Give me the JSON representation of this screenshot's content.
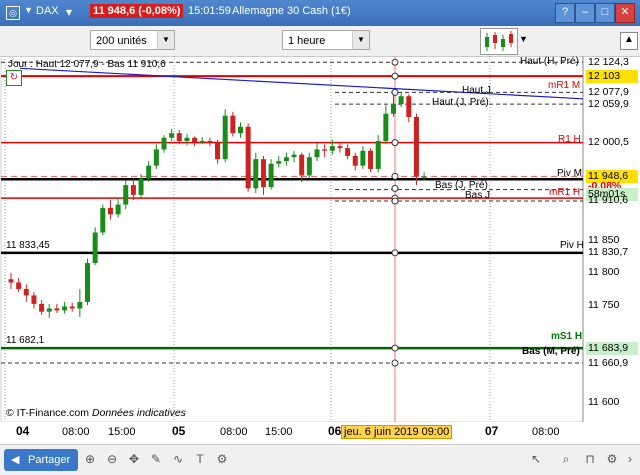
{
  "window": {
    "symbol": "DAX",
    "price_badge": "11 948,6 (-0,08%)",
    "time": "15:01:59",
    "instrument": "Allemagne 30 Cash (1€)"
  },
  "toolbar": {
    "units": "200 unités",
    "timeframe": "1 heure"
  },
  "chart": {
    "info_line": "Jour : Haut 12 077,9 - Bas 11 910,6",
    "copyright": "© IT-Finance.com",
    "disclaimer": "Données indicatives",
    "x_labels": [
      "04",
      "08:00",
      "15:00",
      "05",
      "08:00",
      "15:00",
      "06",
      "07",
      "08:00"
    ],
    "cursor_date": "jeu. 6 juin 2019 09:00",
    "price_axis": [
      "12 124,3",
      "12 103",
      "12 077,9",
      "12 059,9",
      "12 000,5",
      "11 948,6",
      "-0,08%",
      "58m01s",
      "11 910,6",
      "11 850",
      "11 830,7",
      "11 800",
      "11 750",
      "11 683,9",
      "11 660,9",
      "11 600"
    ],
    "levels": {
      "haut_h_pre": "Haut (H, Pré)",
      "mr1_m": "mR1 M",
      "haut_j": "Haut J",
      "haut_j_pre": "Haut (J, Pré)",
      "r1_h": "R1 H",
      "piv_m": "Piv M",
      "bas_j_pre": "Bas (J, Pré)",
      "mr1_h": "mR1 H",
      "bas_j": "Bas J",
      "left_1": "11 833,45",
      "piv_h": "Piv H",
      "left_2": "11 682,1",
      "ms1_h": "mS1 H",
      "bas_m_pre": "Bas (M, Pré)"
    },
    "candles": [
      [
        11790,
        11785,
        11800,
        11775
      ],
      [
        11785,
        11775,
        11792,
        11770
      ],
      [
        11775,
        11765,
        11782,
        11755
      ],
      [
        11765,
        11752,
        11770,
        11745
      ],
      [
        11752,
        11740,
        11758,
        11735
      ],
      [
        11740,
        11745,
        11752,
        11730
      ],
      [
        11745,
        11742,
        11752,
        11738
      ],
      [
        11742,
        11748,
        11755,
        11737
      ],
      [
        11748,
        11745,
        11754,
        11740
      ],
      [
        11745,
        11755,
        11775,
        11732
      ],
      [
        11755,
        11815,
        11822,
        11750
      ],
      [
        11815,
        11862,
        11870,
        11812
      ],
      [
        11862,
        11900,
        11905,
        11858
      ],
      [
        11900,
        11890,
        11912,
        11882
      ],
      [
        11890,
        11905,
        11915,
        11885
      ],
      [
        11905,
        11935,
        11942,
        11898
      ],
      [
        11935,
        11920,
        11945,
        11912
      ],
      [
        11920,
        11945,
        11952,
        11915
      ],
      [
        11945,
        11965,
        11972,
        11940
      ],
      [
        11965,
        11990,
        11998,
        11960
      ],
      [
        11990,
        12008,
        12012,
        11985
      ],
      [
        12008,
        12015,
        12022,
        12003
      ],
      [
        12015,
        12003,
        12020,
        11998
      ],
      [
        12003,
        12008,
        12014,
        11996
      ],
      [
        12008,
        12001,
        12010,
        11995
      ],
      [
        12001,
        12003,
        12009,
        11998
      ],
      [
        12003,
        12000,
        12008,
        11995
      ],
      [
        12000,
        11975,
        12005,
        11968
      ],
      [
        11975,
        12042,
        12052,
        11970
      ],
      [
        12042,
        12015,
        12048,
        12010
      ],
      [
        12015,
        12025,
        12032,
        12008
      ],
      [
        12025,
        11930,
        12030,
        11925
      ],
      [
        11930,
        11975,
        11985,
        11923
      ],
      [
        11975,
        11932,
        11980,
        11920
      ],
      [
        11932,
        11968,
        11975,
        11928
      ],
      [
        11968,
        11972,
        11980,
        11962
      ],
      [
        11972,
        11978,
        11985,
        11965
      ],
      [
        11978,
        11982,
        11988,
        11970
      ],
      [
        11982,
        11950,
        11985,
        11940
      ],
      [
        11950,
        11978,
        11985,
        11945
      ],
      [
        11978,
        11990,
        12000,
        11972
      ],
      [
        11990,
        11988,
        11998,
        11978
      ],
      [
        11988,
        11995,
        12005,
        11982
      ],
      [
        11995,
        11992,
        12000,
        11985
      ],
      [
        11992,
        11980,
        11998,
        11975
      ],
      [
        11980,
        11965,
        11985,
        11958
      ],
      [
        11965,
        11988,
        11995,
        11960
      ],
      [
        11988,
        11960,
        11992,
        11955
      ],
      [
        11960,
        12003,
        12012,
        11955
      ],
      [
        12003,
        12045,
        12058,
        11998
      ],
      [
        12045,
        12060,
        12078,
        12040
      ],
      [
        12060,
        12072,
        12078,
        12055
      ],
      [
        12072,
        12040,
        12075,
        12032
      ],
      [
        12040,
        11948,
        12045,
        11935
      ],
      [
        11948,
        11948,
        11955,
        11942
      ]
    ]
  }
}
